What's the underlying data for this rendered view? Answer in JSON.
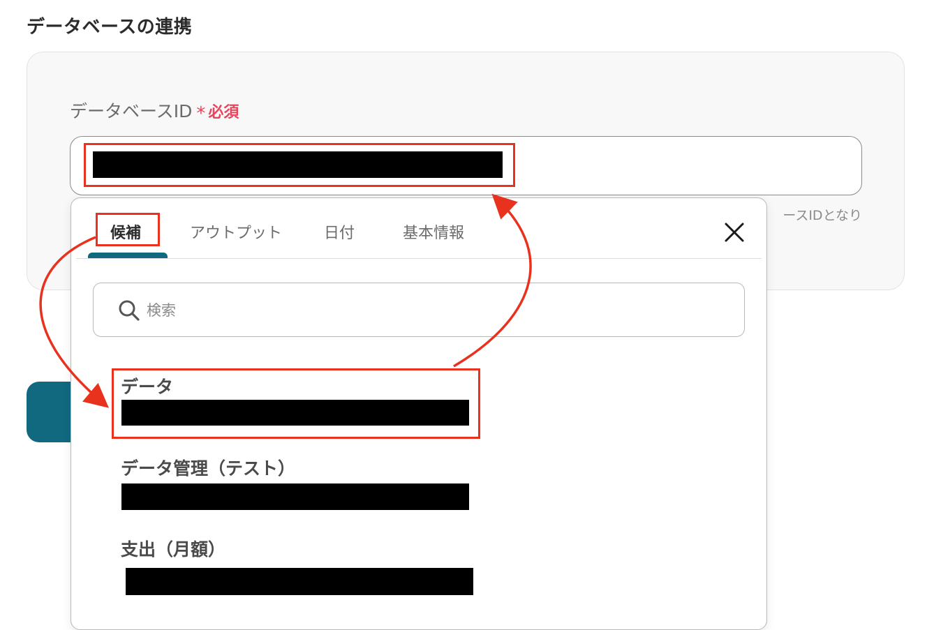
{
  "section": {
    "title": "データベースの連携"
  },
  "field": {
    "label": "データベースID",
    "asterisk": "*",
    "required": "必須",
    "help_text": "ースIDとなり"
  },
  "dropdown": {
    "tabs": [
      "候補",
      "アウトプット",
      "日付",
      "基本情報"
    ],
    "active_tab": "候補",
    "close_icon": "close-icon",
    "search": {
      "placeholder": "検索",
      "value": ""
    },
    "options": [
      {
        "title": "データ"
      },
      {
        "title": "データ管理（テスト）"
      },
      {
        "title": "支出（月額）"
      }
    ]
  },
  "colors": {
    "accent_teal": "#10697f",
    "required_red": "#e8455c",
    "annotation_red": "#e8321e"
  }
}
